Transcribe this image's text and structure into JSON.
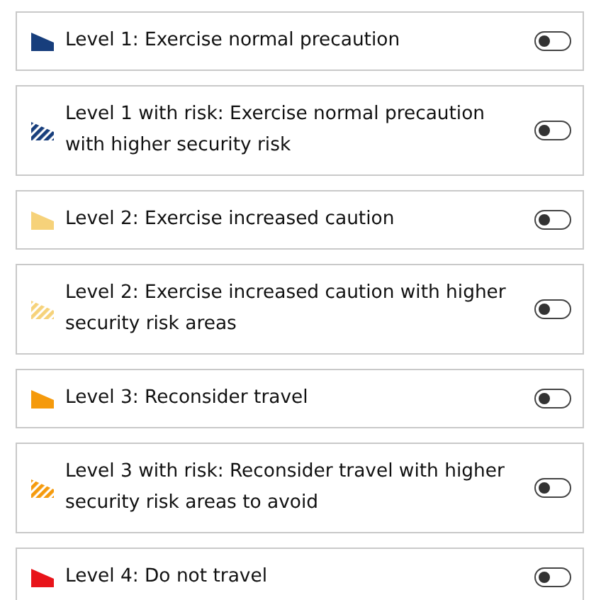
{
  "levels": [
    {
      "label": "Level 1: Exercise normal precaution",
      "color": "#173e7c",
      "kind": "solid",
      "on": false
    },
    {
      "label": "Level 1 with risk: Exercise normal precaution with higher security risk",
      "color": "#173e7c",
      "kind": "hatched",
      "on": false
    },
    {
      "label": "Level 2: Exercise increased caution",
      "color": "#f6d27a",
      "kind": "solid",
      "on": false
    },
    {
      "label": "Level 2: Exercise increased caution with higher security risk areas",
      "color": "#f6d27a",
      "kind": "hatched",
      "on": false
    },
    {
      "label": "Level 3: Reconsider travel",
      "color": "#f59a0c",
      "kind": "solid",
      "on": false
    },
    {
      "label": "Level 3 with risk: Reconsider travel with higher security risk areas to avoid",
      "color": "#f59a0c",
      "kind": "hatched",
      "on": false
    },
    {
      "label": "Level 4: Do not travel",
      "color": "#e8141a",
      "kind": "solid",
      "on": false
    }
  ]
}
